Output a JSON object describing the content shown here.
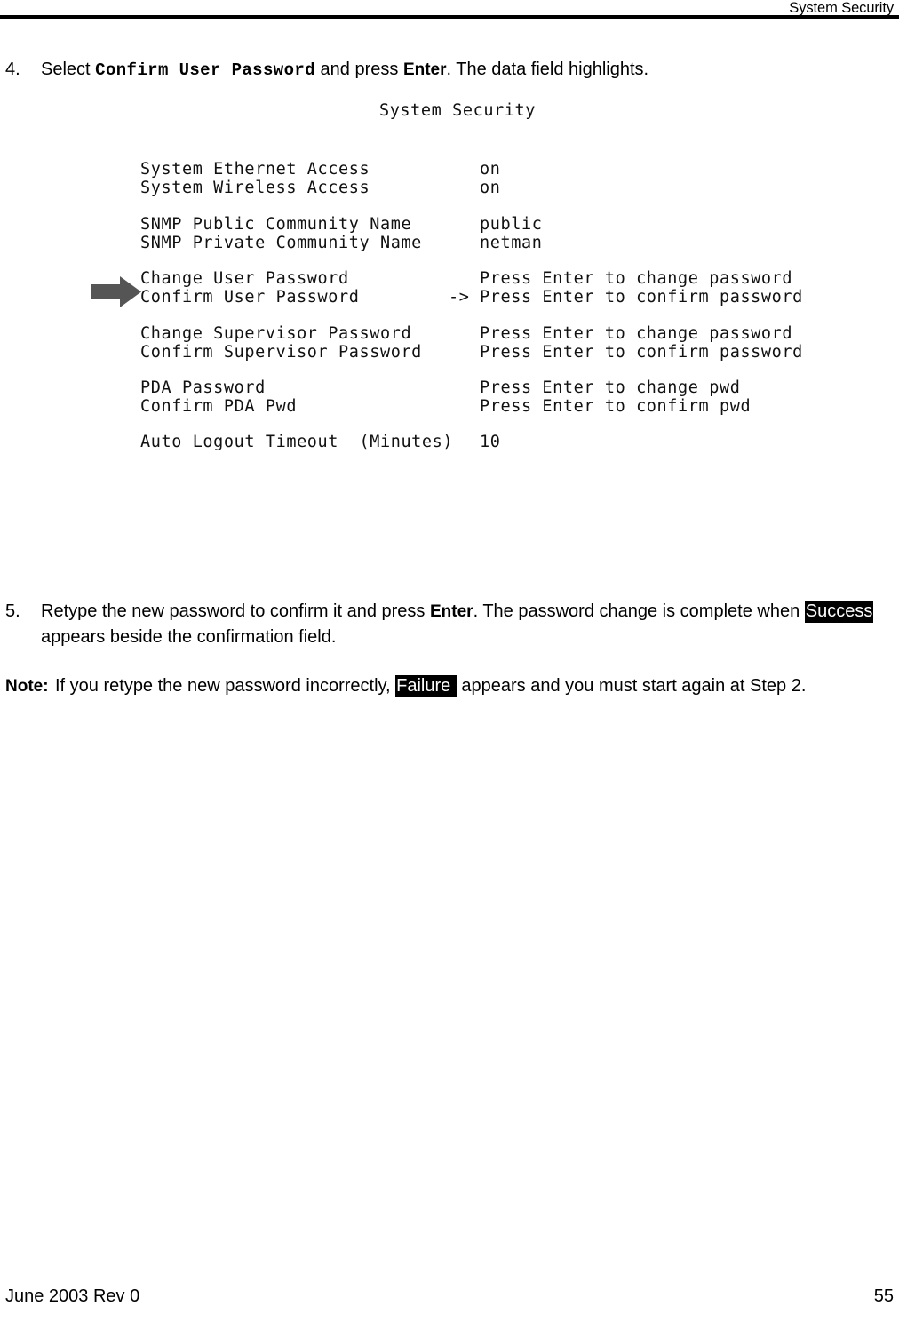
{
  "header": {
    "title": "System Security"
  },
  "steps": [
    {
      "number": "4.",
      "text_before_mono": "Select ",
      "mono_term": "Confirm User Password",
      "text_after_mono": " and press ",
      "bold_key": "Enter",
      "text_end": ". The data field highlights."
    },
    {
      "number": "5.",
      "text_before_key": "Retype the new password to confirm it and press ",
      "bold_key": "Enter",
      "text_after_key": ". The password change is complete when ",
      "inverse_term": "Success",
      "text_end": " appears beside the confirmation field."
    }
  ],
  "note": {
    "label": "Note:",
    "text_before_inverse": "If you retype the new password incorrectly, ",
    "inverse_term": "Failure ",
    "text_after_inverse": " appears and you must start again at Step 2."
  },
  "terminal": {
    "title": "System Security",
    "cursor_marker": "->",
    "rows": [
      {
        "label": "System Ethernet Access",
        "value": "on",
        "cursor": false
      },
      {
        "label": "System Wireless Access",
        "value": "on",
        "cursor": false
      },
      {
        "label": "SNMP Public Community Name",
        "value": "public",
        "cursor": false
      },
      {
        "label": "SNMP Private Community Name",
        "value": "netman",
        "cursor": false
      },
      {
        "label": "Change User Password",
        "value": "Press Enter to change password",
        "cursor": false
      },
      {
        "label": "Confirm User Password",
        "value": "Press Enter to confirm password",
        "cursor": true
      },
      {
        "label": "Change Supervisor Password",
        "value": "Press Enter to change password",
        "cursor": false
      },
      {
        "label": "Confirm Supervisor Password",
        "value": "Press Enter to confirm password",
        "cursor": false
      },
      {
        "label": "PDA Password",
        "value": "Press Enter to change pwd",
        "cursor": false
      },
      {
        "label": "Confirm PDA Pwd",
        "value": "Press Enter to confirm pwd",
        "cursor": false
      },
      {
        "label": "Auto Logout Timeout  (Minutes)",
        "value": "10",
        "cursor": false
      }
    ],
    "selection_arrow_color": "#555555",
    "selected_row_label": "Confirm User Password"
  },
  "footer": {
    "left": "June 2003 Rev 0",
    "right": "55"
  }
}
